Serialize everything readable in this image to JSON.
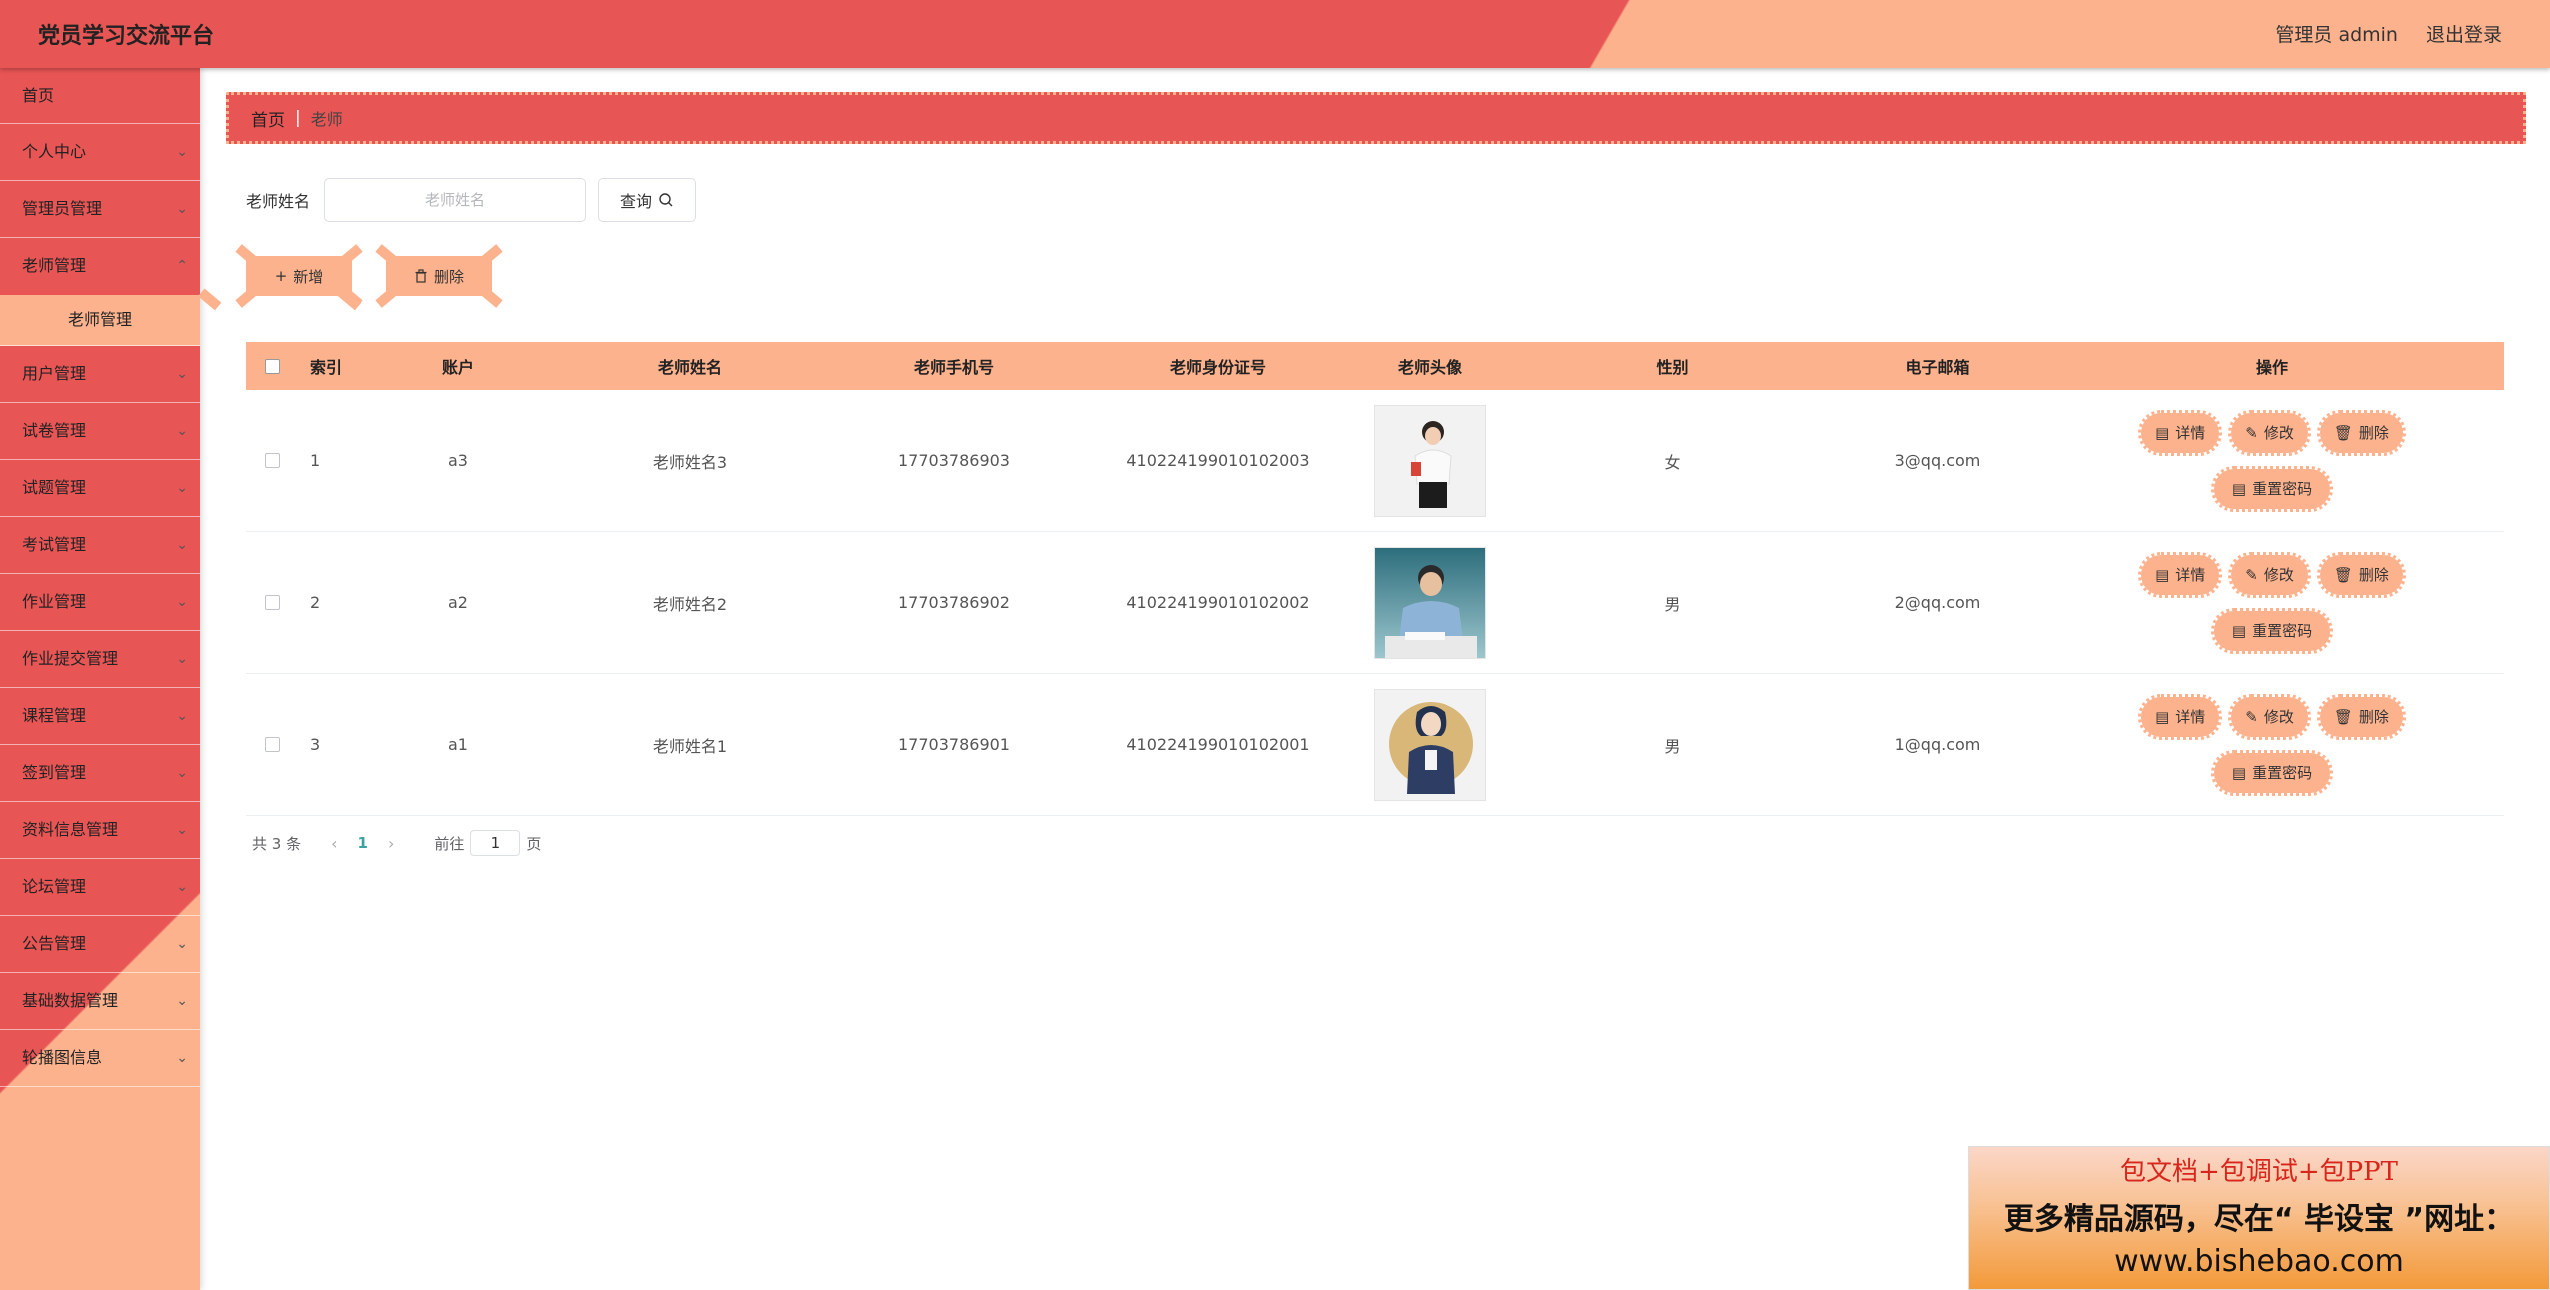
{
  "header": {
    "title": "党员学习交流平台",
    "user": "管理员 admin",
    "logout": "退出登录"
  },
  "sidebar": {
    "items": [
      {
        "label": "首页",
        "expandable": false
      },
      {
        "label": "个人中心",
        "expandable": true
      },
      {
        "label": "管理员管理",
        "expandable": true
      },
      {
        "label": "老师管理",
        "expandable": true
      },
      {
        "label": "用户管理",
        "expandable": true
      },
      {
        "label": "试卷管理",
        "expandable": true
      },
      {
        "label": "试题管理",
        "expandable": true
      },
      {
        "label": "考试管理",
        "expandable": true
      },
      {
        "label": "作业管理",
        "expandable": true
      },
      {
        "label": "作业提交管理",
        "expandable": true
      },
      {
        "label": "课程管理",
        "expandable": true
      },
      {
        "label": "签到管理",
        "expandable": true
      },
      {
        "label": "资料信息管理",
        "expandable": true
      },
      {
        "label": "论坛管理",
        "expandable": true
      },
      {
        "label": "公告管理",
        "expandable": true
      },
      {
        "label": "基础数据管理",
        "expandable": true
      },
      {
        "label": "轮播图信息",
        "expandable": true
      }
    ],
    "active_submenu": "老师管理"
  },
  "breadcrumb": {
    "home": "首页",
    "current": "老师"
  },
  "search": {
    "label": "老师姓名",
    "placeholder": "老师姓名",
    "value": "",
    "button": "查询"
  },
  "actions": {
    "add": "新增",
    "delete": "删除"
  },
  "table": {
    "columns": [
      "索引",
      "账户",
      "老师姓名",
      "老师手机号",
      "老师身份证号",
      "老师头像",
      "性别",
      "电子邮箱",
      "操作"
    ],
    "rows": [
      {
        "index": "1",
        "account": "a3",
        "name": "老师姓名3",
        "phone": "17703786903",
        "id_card": "410224199010102003",
        "avatar": "female-teacher-photo",
        "gender": "女",
        "email": "3@qq.com"
      },
      {
        "index": "2",
        "account": "a2",
        "name": "老师姓名2",
        "phone": "17703786902",
        "id_card": "410224199010102002",
        "avatar": "male-teacher-photo",
        "gender": "男",
        "email": "2@qq.com"
      },
      {
        "index": "3",
        "account": "a1",
        "name": "老师姓名1",
        "phone": "17703786901",
        "id_card": "410224199010102001",
        "avatar": "illustrated-teacher-avatar",
        "gender": "男",
        "email": "1@qq.com"
      }
    ],
    "row_actions": {
      "detail": "详情",
      "edit": "修改",
      "delete": "删除",
      "reset_password": "重置密码"
    }
  },
  "pagination": {
    "total": "共 3 条",
    "current_page": "1",
    "goto_label": "前往",
    "goto_value": "1",
    "page_suffix": "页"
  },
  "watermark": {
    "line1": "包文档+包调试+包PPT",
    "line2": "更多精品源码，尽在“ 毕设宝 ”网址：",
    "line3": "www.bishebao.com"
  },
  "colors": {
    "primary": "#e85555",
    "accent": "#fdb28e",
    "page_active": "#3aa3a0"
  }
}
